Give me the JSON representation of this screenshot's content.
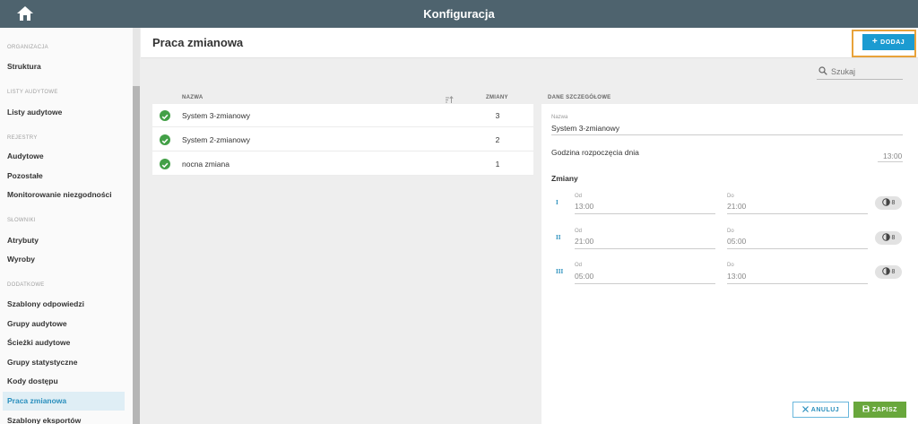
{
  "app": {
    "title": "Konfiguracja"
  },
  "sidebar": {
    "sections": [
      {
        "title": "ORGANIZACJA",
        "items": [
          "Struktura"
        ]
      },
      {
        "title": "LISTY AUDYTOWE",
        "items": [
          "Listy audytowe"
        ]
      },
      {
        "title": "REJESTRY",
        "items": [
          "Audytowe",
          "Pozostałe",
          "Monitorowanie niezgodności"
        ]
      },
      {
        "title": "SŁOWNIKI",
        "items": [
          "Atrybuty",
          "Wyroby"
        ]
      },
      {
        "title": "DODATKOWE",
        "items": [
          "Szablony odpowiedzi",
          "Grupy audytowe",
          "Ścieżki audytowe",
          "Grupy statystyczne",
          "Kody dostępu",
          "Praca zmianowa",
          "Szablony eksportów"
        ]
      }
    ],
    "active_item": "Praca zmianowa"
  },
  "header": {
    "title": "Praca zmianowa",
    "add_label": "DODAJ"
  },
  "search": {
    "placeholder": "Szukaj"
  },
  "list": {
    "columns": {
      "name": "NAZWA",
      "shifts": "ZMIANY"
    },
    "rows": [
      {
        "name": "System 3-zmianowy",
        "shifts": "3"
      },
      {
        "name": "System 2-zmianowy",
        "shifts": "2"
      },
      {
        "name": "nocna zmiana",
        "shifts": "1"
      }
    ]
  },
  "details": {
    "title": "DANE SZCZEGÓŁOWE",
    "name_label": "Nazwa",
    "name_value": "System 3-zmianowy",
    "day_start_label": "Godzina rozpoczęcia dnia",
    "day_start_value": "13:00",
    "shifts_title": "Zmiany",
    "shifts": [
      {
        "roman": "I",
        "from_label": "Od",
        "from": "13:00",
        "to_label": "Do",
        "to": "21:00",
        "hours": "8"
      },
      {
        "roman": "II",
        "from_label": "Od",
        "from": "21:00",
        "to_label": "Do",
        "to": "05:00",
        "hours": "8"
      },
      {
        "roman": "III",
        "from_label": "Od",
        "from": "05:00",
        "to_label": "Do",
        "to": "13:00",
        "hours": "8"
      }
    ]
  },
  "footer": {
    "cancel_label": "ANULUJ",
    "save_label": "ZAPISZ"
  },
  "colors": {
    "topbar": "#4e636e",
    "accent": "#1b9bd1",
    "active_text": "#2a8fbd",
    "success": "#43a047",
    "save": "#69a73c",
    "highlight": "#e8a23a"
  }
}
